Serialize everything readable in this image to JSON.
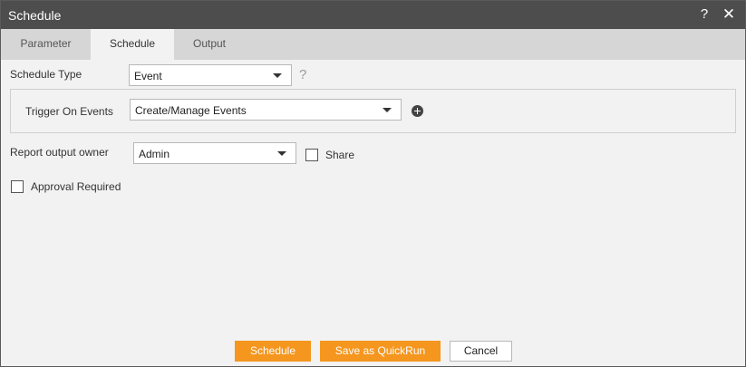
{
  "window": {
    "title": "Schedule",
    "help_glyph": "?",
    "close_glyph": "✕"
  },
  "tabs": [
    {
      "label": "Parameter",
      "active": false
    },
    {
      "label": "Schedule",
      "active": true
    },
    {
      "label": "Output",
      "active": false
    }
  ],
  "form": {
    "schedule_type": {
      "label": "Schedule Type",
      "value": "Event",
      "help_glyph": "?"
    },
    "trigger": {
      "label": "Trigger On Events",
      "value": "Create/Manage Events"
    },
    "owner": {
      "label": "Report output owner",
      "value": "Admin"
    },
    "share": {
      "label": "Share",
      "checked": false
    },
    "approval": {
      "label": "Approval Required",
      "checked": false
    }
  },
  "actions": {
    "schedule": "Schedule",
    "save_quickrun": "Save as QuickRun",
    "cancel": "Cancel"
  },
  "colors": {
    "titlebar": "#4d4d4d",
    "accent": "#f5961e",
    "tabbar": "#d6d6d6",
    "panel": "#f2f2f2"
  },
  "icons": {
    "help": "question-mark-icon",
    "close": "close-icon",
    "dropdown": "caret-down-icon",
    "add": "plus-circle-icon"
  }
}
